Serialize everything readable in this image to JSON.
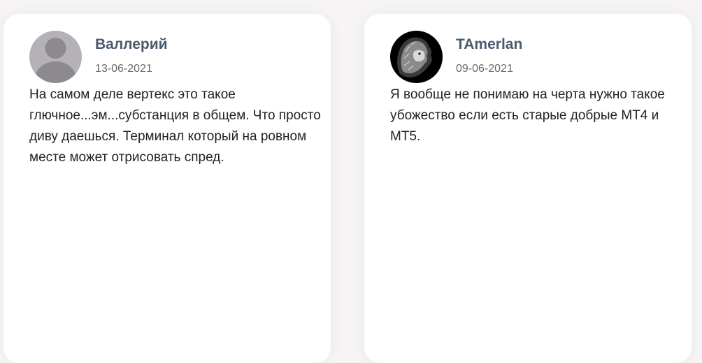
{
  "reviews": [
    {
      "author": "Валлерий",
      "date": "13-06-2021",
      "avatar": "default-user-avatar",
      "text": "На самом деле вертекс это такое глючное...эм...субстанция в общем. Что просто диву даешься. Терминал который на ровном месте может отрисовать спред."
    },
    {
      "author": "TAmerlan",
      "date": "09-06-2021",
      "avatar": "lion-photo-avatar",
      "text": "Я вообще не понимаю на черта нужно такое убожество если есть старые добрые МТ4 и МТ5."
    }
  ],
  "colors": {
    "author": "#4a5a6e",
    "date": "#666a70",
    "text": "#222222",
    "card": "#ffffff",
    "background": "#f6f4f5"
  }
}
